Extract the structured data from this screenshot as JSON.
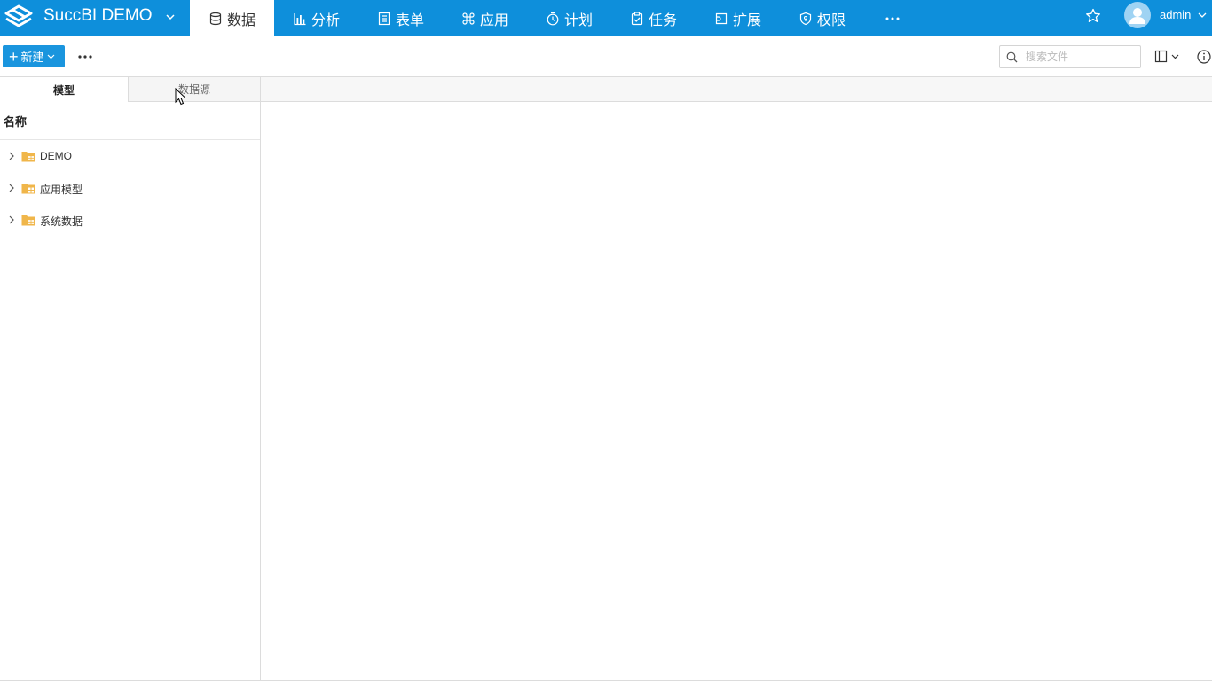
{
  "app": {
    "title": "SuccBI DEMO"
  },
  "nav": {
    "items": [
      {
        "label": "数据",
        "icon": "database-icon",
        "active": true
      },
      {
        "label": "分析",
        "icon": "bar-chart-icon",
        "active": false
      },
      {
        "label": "表单",
        "icon": "form-icon",
        "active": false
      },
      {
        "label": "应用",
        "icon": "command-icon",
        "active": false
      },
      {
        "label": "计划",
        "icon": "timer-icon",
        "active": false
      },
      {
        "label": "任务",
        "icon": "clipboard-check-icon",
        "active": false
      },
      {
        "label": "扩展",
        "icon": "extension-icon",
        "active": false
      },
      {
        "label": "权限",
        "icon": "shield-icon",
        "active": false
      }
    ]
  },
  "user": {
    "name": "admin"
  },
  "toolbar": {
    "new_label": "新建"
  },
  "search": {
    "placeholder": "搜索文件"
  },
  "left_panel": {
    "tabs": [
      {
        "label": "模型",
        "active": true
      },
      {
        "label": "数据源",
        "active": false
      }
    ],
    "column_header": "名称",
    "tree": [
      {
        "label": "DEMO",
        "icon": "folder-model-icon"
      },
      {
        "label": "应用模型",
        "icon": "folder-app-icon"
      },
      {
        "label": "系统数据",
        "icon": "folder-system-icon"
      }
    ]
  },
  "colors": {
    "primary": "#0e8fdb",
    "button": "#1a95de",
    "folder": "#f0b64a"
  }
}
